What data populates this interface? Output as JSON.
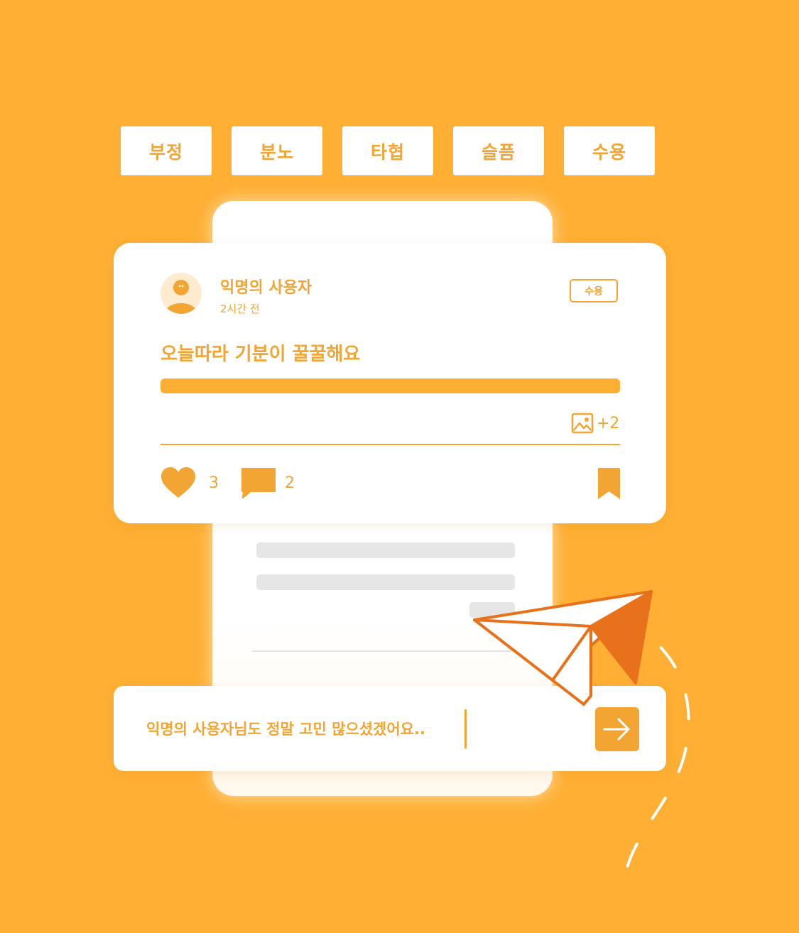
{
  "tabs": [
    {
      "label": "부정"
    },
    {
      "label": "분노"
    },
    {
      "label": "타협"
    },
    {
      "label": "슬픔"
    },
    {
      "label": "수용"
    }
  ],
  "post": {
    "author": "익명의 사용자",
    "time": "2시간 전",
    "badge": "수용",
    "title": "오늘따라 기분이 꿀꿀해요",
    "image_count": "+2",
    "likes": "3",
    "comments": "2"
  },
  "reply": {
    "text": "익명의 사용자님도 정말 고민 많으셨겠어요.."
  },
  "icons": [
    "avatar-icon",
    "image-icon",
    "heart-icon",
    "comment-icon",
    "bookmark-icon",
    "arrow-right-icon",
    "paper-plane-icon"
  ],
  "colors": {
    "background": "#FFAF33",
    "accent": "#F2A533",
    "plane": "#E8721C",
    "skeleton": "#E6E6E6"
  }
}
